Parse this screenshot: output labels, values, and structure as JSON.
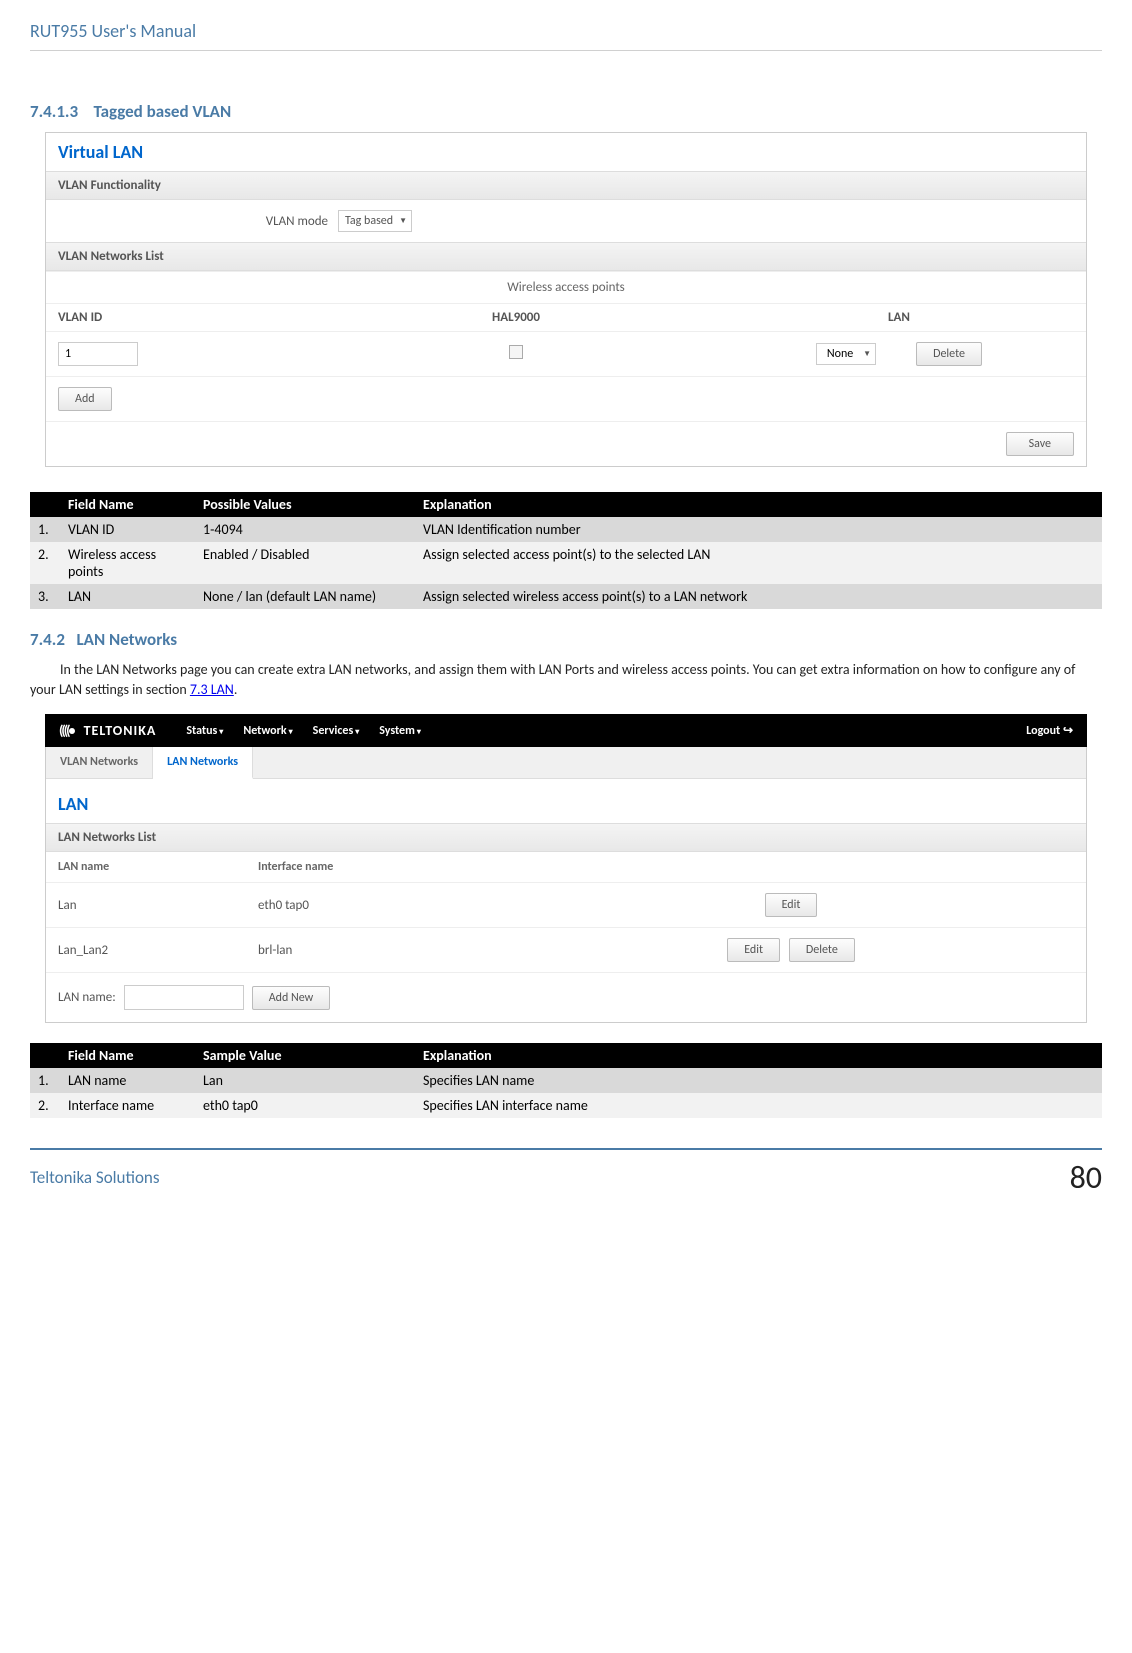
{
  "header": {
    "title": "RUT955 User's Manual"
  },
  "section1": {
    "number": "7.4.1.3",
    "title": "Tagged based VLAN"
  },
  "screenshot1": {
    "title": "Virtual LAN",
    "func_header": "VLAN Functionality",
    "vlan_mode_label": "VLAN mode",
    "vlan_mode_value": "Tag based",
    "networks_header": "VLAN Networks List",
    "wireless_label": "Wireless access points",
    "col_vlanid": "VLAN ID",
    "col_hal": "HAL9000",
    "col_lan": "LAN",
    "vlanid_value": "1",
    "lan_selected": "None",
    "delete_btn": "Delete",
    "add_btn": "Add",
    "save_btn": "Save"
  },
  "table1": {
    "header": {
      "num": "",
      "field": "Field Name",
      "val": "Possible Values",
      "exp": "Explanation"
    },
    "rows": [
      {
        "num": "1.",
        "field": "VLAN ID",
        "val": "1-4094",
        "exp": "VLAN Identification number"
      },
      {
        "num": "2.",
        "field": "Wireless access points",
        "val": "Enabled / Disabled",
        "exp": "Assign selected access point(s) to the selected LAN"
      },
      {
        "num": "3.",
        "field": "LAN",
        "val": "None / lan (default LAN name)",
        "exp": "Assign selected wireless access point(s) to a LAN network"
      }
    ]
  },
  "section2": {
    "number": "7.4.2",
    "title": "LAN Networks",
    "body_part1": "In the LAN Networks page you can create extra LAN networks, and assign them with LAN Ports and wireless access points. You can get extra information on how to configure any of your LAN settings in section ",
    "link_text": "7.3 LAN",
    "body_part2": "."
  },
  "screenshot2": {
    "logo": "TELTONIKA",
    "nav": {
      "status": "Status",
      "network": "Network",
      "services": "Services",
      "system": "System",
      "logout": "Logout"
    },
    "tabs": {
      "vlan": "VLAN Networks",
      "lan": "LAN Networks"
    },
    "title": "LAN",
    "list_header": "LAN Networks List",
    "col_lanname": "LAN name",
    "col_ifname": "Interface name",
    "rows": [
      {
        "name": "Lan",
        "iface": "eth0 tap0",
        "buttons": {
          "edit": "Edit"
        }
      },
      {
        "name": "Lan_Lan2",
        "iface": "brl-lan",
        "buttons": {
          "edit": "Edit",
          "delete": "Delete"
        }
      }
    ],
    "input_label": "LAN name:",
    "addnew_btn": "Add New"
  },
  "table2": {
    "header": {
      "num": "",
      "field": "Field Name",
      "val": "Sample Value",
      "exp": "Explanation"
    },
    "rows": [
      {
        "num": "1.",
        "field": "LAN name",
        "val": "Lan",
        "exp": "Specifies LAN name"
      },
      {
        "num": "2.",
        "field": "Interface name",
        "val": "eth0 tap0",
        "exp": "Specifies LAN interface name"
      }
    ]
  },
  "footer": {
    "text": "Teltonika Solutions",
    "page": "80"
  }
}
